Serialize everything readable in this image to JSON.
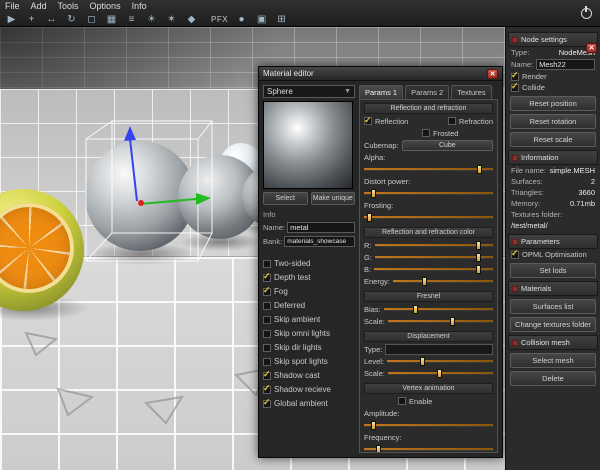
{
  "colors": {
    "accent_check": "#e8c63a",
    "slider_track": "#c07818",
    "close_button": "#b43a2e",
    "gizmo_x_axis": "#dd2222",
    "gizmo_y_axis": "#22bb22",
    "gizmo_z_axis": "#3344ee",
    "panel_bg": "#262626"
  },
  "topbar": {
    "menus": [
      "File",
      "Add",
      "Tools",
      "Options",
      "Info"
    ],
    "pfx_label": "PFX",
    "icons": [
      {
        "name": "select-tool-icon",
        "glyph": "▶"
      },
      {
        "name": "add-node-icon",
        "glyph": "+"
      },
      {
        "name": "move-tool-icon",
        "glyph": "↔"
      },
      {
        "name": "rotate-tool-icon",
        "glyph": "↻"
      },
      {
        "name": "scale-tool-icon",
        "glyph": "◻"
      },
      {
        "name": "grid-icon",
        "glyph": "▦"
      },
      {
        "name": "list-icon",
        "glyph": "≡"
      },
      {
        "name": "light-icon",
        "glyph": "☀"
      },
      {
        "name": "particles-icon",
        "glyph": "✶"
      },
      {
        "name": "material-icon",
        "glyph": "◆"
      },
      {
        "name": "render-icon",
        "glyph": "●"
      },
      {
        "name": "mesh-icon",
        "glyph": "▣"
      },
      {
        "name": "physics-icon",
        "glyph": "⊞"
      }
    ]
  },
  "material_editor": {
    "title": "Material editor",
    "shape_selector": "Sphere",
    "select_button": "Select",
    "make_unique_button": "Make unique",
    "info_header": "Info",
    "name_label": "Name:",
    "name_value": "metal",
    "bank_label": "Bank:",
    "bank_value": "materials_showcase",
    "flags": [
      {
        "label": "Two-sided",
        "checked": false
      },
      {
        "label": "Depth test",
        "checked": true
      },
      {
        "label": "Fog",
        "checked": true
      },
      {
        "label": "Deferred",
        "checked": false
      },
      {
        "label": "Skip ambient",
        "checked": false
      },
      {
        "label": "Skip omni lights",
        "checked": false
      },
      {
        "label": "Skip dir lights",
        "checked": false
      },
      {
        "label": "Skip spot lights",
        "checked": false
      },
      {
        "label": "Shadow cast",
        "checked": true
      },
      {
        "label": "Shadow recieve",
        "checked": true
      },
      {
        "label": "Global ambient",
        "checked": true
      }
    ],
    "tabs": [
      {
        "label": "Params 1",
        "active": true
      },
      {
        "label": "Params 2",
        "active": false
      },
      {
        "label": "Textures",
        "active": false
      }
    ],
    "params1": {
      "reflection": {
        "title": "Reflection and refraction",
        "reflection": {
          "label": "Reflection",
          "checked": true
        },
        "refraction": {
          "label": "Refraction",
          "checked": false
        },
        "frosted": {
          "label": "Frosted",
          "checked": false
        },
        "cubemap_label": "Cubemap:",
        "cubemap_value": "Cube",
        "alpha": {
          "label": "Alpha:",
          "value": 90
        },
        "distort": {
          "label": "Distort power:",
          "value": 8
        },
        "frosting": {
          "label": "Frosting:",
          "value": 5
        }
      },
      "color": {
        "title": "Reflection and refraction color",
        "r": {
          "label": "R:",
          "value": 88
        },
        "g": {
          "label": "G:",
          "value": 88
        },
        "b": {
          "label": "B:",
          "value": 88
        },
        "energy": {
          "label": "Energy:",
          "value": 32
        }
      },
      "fresnel": {
        "title": "Fresnel",
        "bias": {
          "label": "Bias:",
          "value": 30
        },
        "scale": {
          "label": "Scale:",
          "value": 62
        }
      },
      "displacement": {
        "title": "Displacement",
        "type_label": "Type:",
        "type_value": "",
        "level": {
          "label": "Level:",
          "value": 34
        },
        "scale": {
          "label": "Scale:",
          "value": 50
        }
      },
      "vertex": {
        "title": "Vertex animation",
        "enable": {
          "label": "Enable",
          "checked": false
        },
        "amplitude": {
          "label": "Amplitude:",
          "value": 8
        },
        "frequency": {
          "label": "Frequency:",
          "value": 12
        }
      }
    }
  },
  "sidebar": {
    "node_settings": {
      "title": "Node settings",
      "type_label": "Type:",
      "type_value": "NodeMesh",
      "name_label": "Name:",
      "name_value": "Mesh22",
      "flags": [
        {
          "label": "Render",
          "checked": true
        },
        {
          "label": "Collide",
          "checked": true
        }
      ],
      "buttons": [
        "Reset position",
        "Reset rotation",
        "Reset scale"
      ]
    },
    "information": {
      "title": "Information",
      "rows": [
        {
          "label": "File name:",
          "value": "simple.MESH"
        },
        {
          "label": "Surfaces:",
          "value": "2"
        },
        {
          "label": "Triangles:",
          "value": "3660"
        },
        {
          "label": "Memory:",
          "value": "0.71mb"
        }
      ],
      "folder_label": "Textures folder:",
      "folder_value": "/test/metal/"
    },
    "parameters": {
      "title": "Parameters",
      "flags": [
        {
          "label": "OPML Optimisation",
          "checked": true
        }
      ],
      "buttons": [
        "Set lods"
      ]
    },
    "materials": {
      "title": "Materials",
      "buttons": [
        "Surfaces list",
        "Change textures folder"
      ]
    },
    "collision_mesh": {
      "title": "Collision mesh",
      "buttons": [
        "Select mesh",
        "Delete"
      ]
    }
  }
}
